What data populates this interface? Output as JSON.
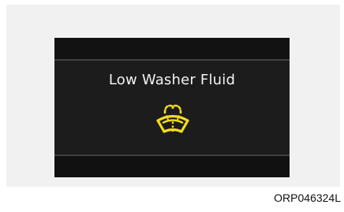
{
  "display": {
    "message": "Low Washer Fluid",
    "icon": "washer-fluid-warning-icon",
    "icon_color": "#f4dc1e",
    "background_color": "#1c1c1c",
    "text_color": "#f2f2f2"
  },
  "figure": {
    "code": "ORP046324L"
  }
}
